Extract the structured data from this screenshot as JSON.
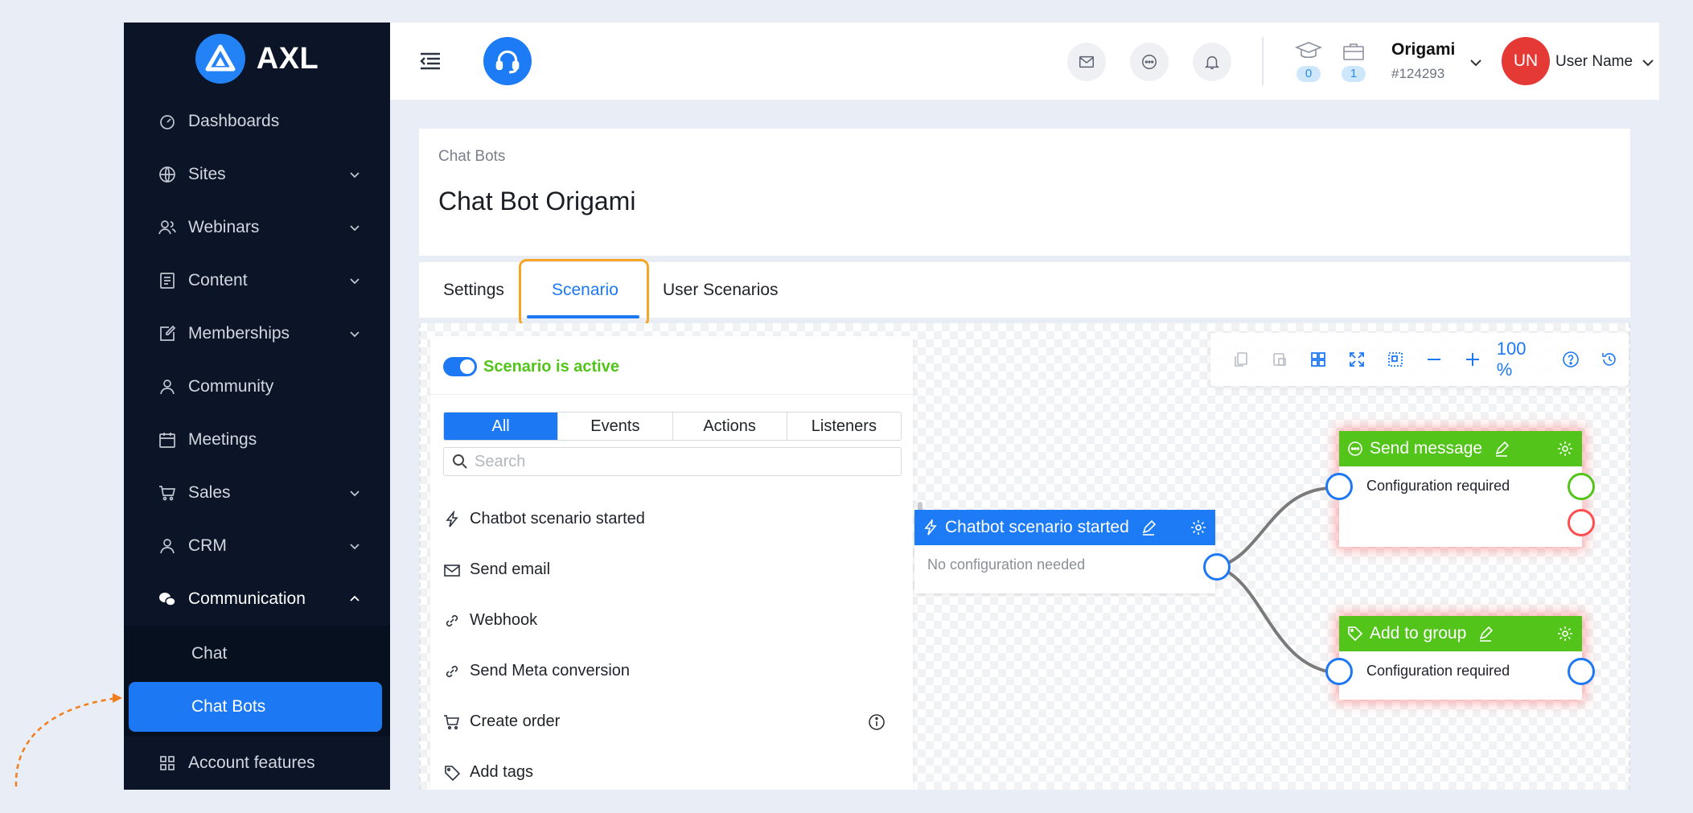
{
  "brand": {
    "name": "AXL",
    "color": "#2383f6"
  },
  "sidebar": {
    "items": [
      {
        "label": "Dashboards",
        "icon": "dashboard-icon",
        "expandable": false
      },
      {
        "label": "Sites",
        "icon": "globe-icon",
        "expandable": true
      },
      {
        "label": "Webinars",
        "icon": "webinar-icon",
        "expandable": true
      },
      {
        "label": "Content",
        "icon": "content-icon",
        "expandable": true
      },
      {
        "label": "Memberships",
        "icon": "membership-icon",
        "expandable": true
      },
      {
        "label": "Community",
        "icon": "community-icon",
        "expandable": false
      },
      {
        "label": "Meetings",
        "icon": "calendar-icon",
        "expandable": false
      },
      {
        "label": "Sales",
        "icon": "cart-icon",
        "expandable": true
      },
      {
        "label": "CRM",
        "icon": "user-icon",
        "expandable": true
      },
      {
        "label": "Communication",
        "icon": "wechat-icon",
        "expandable": true,
        "open": true
      }
    ],
    "communication_sub": [
      {
        "label": "Chat"
      },
      {
        "label": "Chat Bots",
        "active": true
      }
    ],
    "after": [
      {
        "label": "Account features",
        "icon": "grid-icon"
      }
    ]
  },
  "topbar": {
    "education_count": "0",
    "cases_count": "1",
    "account_name": "Origami",
    "account_id": "#124293",
    "avatar_initials": "UN",
    "user_name": "User Name"
  },
  "page": {
    "breadcrumb": "Chat Bots",
    "title": "Chat Bot Origami"
  },
  "tabs": [
    "Settings",
    "Scenario",
    "User Scenarios"
  ],
  "active_tab": "Scenario",
  "panel": {
    "toggle_label": "Scenario is active",
    "filters": [
      "All",
      "Events",
      "Actions",
      "Listeners"
    ],
    "active_filter": "All",
    "search_placeholder": "Search",
    "items": [
      {
        "label": "Chatbot scenario started",
        "icon": "lightning-icon"
      },
      {
        "label": "Send email",
        "icon": "mail-icon"
      },
      {
        "label": "Webhook",
        "icon": "link-icon"
      },
      {
        "label": "Send Meta conversion",
        "icon": "link-icon"
      },
      {
        "label": "Create order",
        "icon": "cart-icon",
        "info": true
      },
      {
        "label": "Add tags",
        "icon": "tag-icon"
      }
    ]
  },
  "toolbar": {
    "zoom": "100 %"
  },
  "nodes": {
    "start": {
      "title": "Chatbot scenario started",
      "body": "No configuration needed"
    },
    "send_message": {
      "title": "Send message",
      "body": "Configuration required"
    },
    "add_to_group": {
      "title": "Add to group",
      "body": "Configuration required"
    }
  },
  "colors": {
    "accent": "#1d79f3",
    "success": "#52c41a",
    "danger": "#ff4d4f",
    "highlight": "#f5a623",
    "sidebar_bg": "#0b1527"
  }
}
